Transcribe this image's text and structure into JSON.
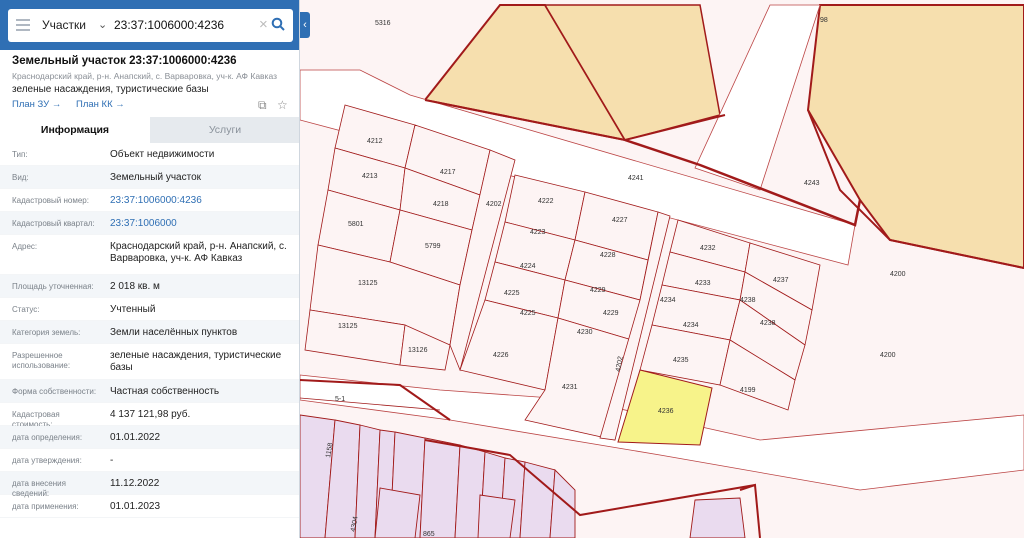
{
  "search": {
    "category": "Участки",
    "query": "23:37:1006000:4236"
  },
  "parcel": {
    "title": "Земельный участок 23:37:1006000:4236",
    "address": "Краснодарский край, р-н. Анапский, с. Варваровка, уч-к. АФ Кавказ",
    "use": "зеленые насаждения, туристические базы",
    "link_plan_zu": "План ЗУ →",
    "link_plan_kk": "План КК →"
  },
  "tabs": [
    "Информация",
    "Услуги"
  ],
  "rows": [
    {
      "label": "Тип:",
      "value": "Объект недвижимости"
    },
    {
      "label": "Вид:",
      "value": "Земельный участок"
    },
    {
      "label": "Кадастровый номер:",
      "value": "23:37:1006000:4236",
      "link": true
    },
    {
      "label": "Кадастровый квартал:",
      "value": "23:37:1006000",
      "link": true
    },
    {
      "label": "Адрес:",
      "value": "Краснодарский край, р-н. Анапский, с. Варваровка, уч-к. АФ Кавказ"
    },
    {
      "label": "Площадь уточненная:",
      "value": "2 018 кв. м"
    },
    {
      "label": "Статус:",
      "value": "Учтенный"
    },
    {
      "label": "Категория земель:",
      "value": "Земли населённых пунктов"
    },
    {
      "label": "Разрешенное использование:",
      "value": "зеленые насаждения, туристические базы"
    },
    {
      "label": "Форма собственности:",
      "value": "Частная собственность"
    },
    {
      "label": "Кадастровая стоимость:",
      "value": "4 137 121,98 руб."
    },
    {
      "label": "дата определения:",
      "value": "01.01.2022"
    },
    {
      "label": "дата утверждения:",
      "value": "-"
    },
    {
      "label": "дата внесения сведений:",
      "value": "11.12.2022"
    },
    {
      "label": "дата применения:",
      "value": "01.01.2023"
    }
  ],
  "map": {
    "parcel_labels": [
      "5316",
      "98",
      "4212",
      "4217",
      "4213",
      "4218",
      "5801",
      "5799",
      "4202",
      "4222",
      "4227",
      "4223",
      "4228",
      "4224",
      "4229",
      "4225",
      "4225",
      "4229",
      "4230",
      "4226",
      "4231",
      "4232",
      "4237",
      "4233",
      "4238",
      "4234",
      "4238",
      "4234",
      "4235",
      "4199",
      "4236",
      "13125",
      "13125",
      "13126",
      "4241",
      "4243",
      "4200",
      "4200",
      "4202",
      "1158",
      "4304",
      "865",
      "5-1"
    ],
    "colors": {
      "selected": "#f7f38a",
      "orange": "#f6dfae",
      "purple": "#eadbef",
      "boundary": "#a11a1a",
      "road": "#c77"
    }
  }
}
